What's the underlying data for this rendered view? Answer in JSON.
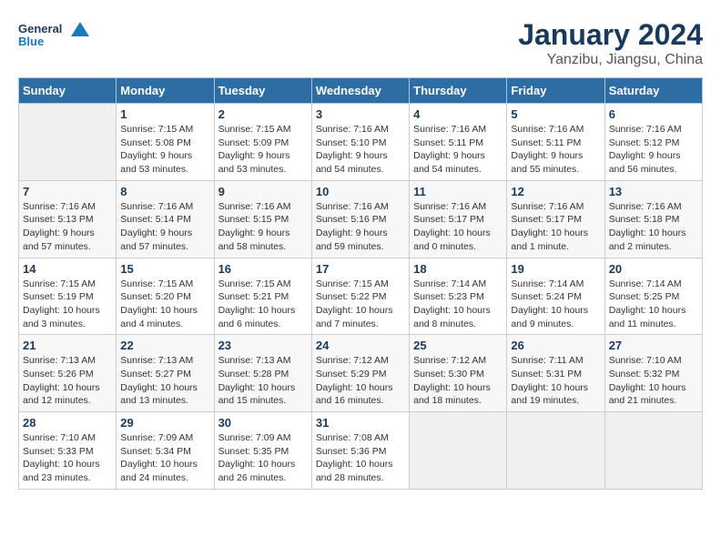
{
  "logo": {
    "text_general": "General",
    "text_blue": "Blue"
  },
  "title": "January 2024",
  "subtitle": "Yanzibu, Jiangsu, China",
  "headers": [
    "Sunday",
    "Monday",
    "Tuesday",
    "Wednesday",
    "Thursday",
    "Friday",
    "Saturday"
  ],
  "weeks": [
    [
      {
        "day": "",
        "info": ""
      },
      {
        "day": "1",
        "info": "Sunrise: 7:15 AM\nSunset: 5:08 PM\nDaylight: 9 hours\nand 53 minutes."
      },
      {
        "day": "2",
        "info": "Sunrise: 7:15 AM\nSunset: 5:09 PM\nDaylight: 9 hours\nand 53 minutes."
      },
      {
        "day": "3",
        "info": "Sunrise: 7:16 AM\nSunset: 5:10 PM\nDaylight: 9 hours\nand 54 minutes."
      },
      {
        "day": "4",
        "info": "Sunrise: 7:16 AM\nSunset: 5:11 PM\nDaylight: 9 hours\nand 54 minutes."
      },
      {
        "day": "5",
        "info": "Sunrise: 7:16 AM\nSunset: 5:11 PM\nDaylight: 9 hours\nand 55 minutes."
      },
      {
        "day": "6",
        "info": "Sunrise: 7:16 AM\nSunset: 5:12 PM\nDaylight: 9 hours\nand 56 minutes."
      }
    ],
    [
      {
        "day": "7",
        "info": "Sunrise: 7:16 AM\nSunset: 5:13 PM\nDaylight: 9 hours\nand 57 minutes."
      },
      {
        "day": "8",
        "info": "Sunrise: 7:16 AM\nSunset: 5:14 PM\nDaylight: 9 hours\nand 57 minutes."
      },
      {
        "day": "9",
        "info": "Sunrise: 7:16 AM\nSunset: 5:15 PM\nDaylight: 9 hours\nand 58 minutes."
      },
      {
        "day": "10",
        "info": "Sunrise: 7:16 AM\nSunset: 5:16 PM\nDaylight: 9 hours\nand 59 minutes."
      },
      {
        "day": "11",
        "info": "Sunrise: 7:16 AM\nSunset: 5:17 PM\nDaylight: 10 hours\nand 0 minutes."
      },
      {
        "day": "12",
        "info": "Sunrise: 7:16 AM\nSunset: 5:17 PM\nDaylight: 10 hours\nand 1 minute."
      },
      {
        "day": "13",
        "info": "Sunrise: 7:16 AM\nSunset: 5:18 PM\nDaylight: 10 hours\nand 2 minutes."
      }
    ],
    [
      {
        "day": "14",
        "info": "Sunrise: 7:15 AM\nSunset: 5:19 PM\nDaylight: 10 hours\nand 3 minutes."
      },
      {
        "day": "15",
        "info": "Sunrise: 7:15 AM\nSunset: 5:20 PM\nDaylight: 10 hours\nand 4 minutes."
      },
      {
        "day": "16",
        "info": "Sunrise: 7:15 AM\nSunset: 5:21 PM\nDaylight: 10 hours\nand 6 minutes."
      },
      {
        "day": "17",
        "info": "Sunrise: 7:15 AM\nSunset: 5:22 PM\nDaylight: 10 hours\nand 7 minutes."
      },
      {
        "day": "18",
        "info": "Sunrise: 7:14 AM\nSunset: 5:23 PM\nDaylight: 10 hours\nand 8 minutes."
      },
      {
        "day": "19",
        "info": "Sunrise: 7:14 AM\nSunset: 5:24 PM\nDaylight: 10 hours\nand 9 minutes."
      },
      {
        "day": "20",
        "info": "Sunrise: 7:14 AM\nSunset: 5:25 PM\nDaylight: 10 hours\nand 11 minutes."
      }
    ],
    [
      {
        "day": "21",
        "info": "Sunrise: 7:13 AM\nSunset: 5:26 PM\nDaylight: 10 hours\nand 12 minutes."
      },
      {
        "day": "22",
        "info": "Sunrise: 7:13 AM\nSunset: 5:27 PM\nDaylight: 10 hours\nand 13 minutes."
      },
      {
        "day": "23",
        "info": "Sunrise: 7:13 AM\nSunset: 5:28 PM\nDaylight: 10 hours\nand 15 minutes."
      },
      {
        "day": "24",
        "info": "Sunrise: 7:12 AM\nSunset: 5:29 PM\nDaylight: 10 hours\nand 16 minutes."
      },
      {
        "day": "25",
        "info": "Sunrise: 7:12 AM\nSunset: 5:30 PM\nDaylight: 10 hours\nand 18 minutes."
      },
      {
        "day": "26",
        "info": "Sunrise: 7:11 AM\nSunset: 5:31 PM\nDaylight: 10 hours\nand 19 minutes."
      },
      {
        "day": "27",
        "info": "Sunrise: 7:10 AM\nSunset: 5:32 PM\nDaylight: 10 hours\nand 21 minutes."
      }
    ],
    [
      {
        "day": "28",
        "info": "Sunrise: 7:10 AM\nSunset: 5:33 PM\nDaylight: 10 hours\nand 23 minutes."
      },
      {
        "day": "29",
        "info": "Sunrise: 7:09 AM\nSunset: 5:34 PM\nDaylight: 10 hours\nand 24 minutes."
      },
      {
        "day": "30",
        "info": "Sunrise: 7:09 AM\nSunset: 5:35 PM\nDaylight: 10 hours\nand 26 minutes."
      },
      {
        "day": "31",
        "info": "Sunrise: 7:08 AM\nSunset: 5:36 PM\nDaylight: 10 hours\nand 28 minutes."
      },
      {
        "day": "",
        "info": ""
      },
      {
        "day": "",
        "info": ""
      },
      {
        "day": "",
        "info": ""
      }
    ]
  ]
}
